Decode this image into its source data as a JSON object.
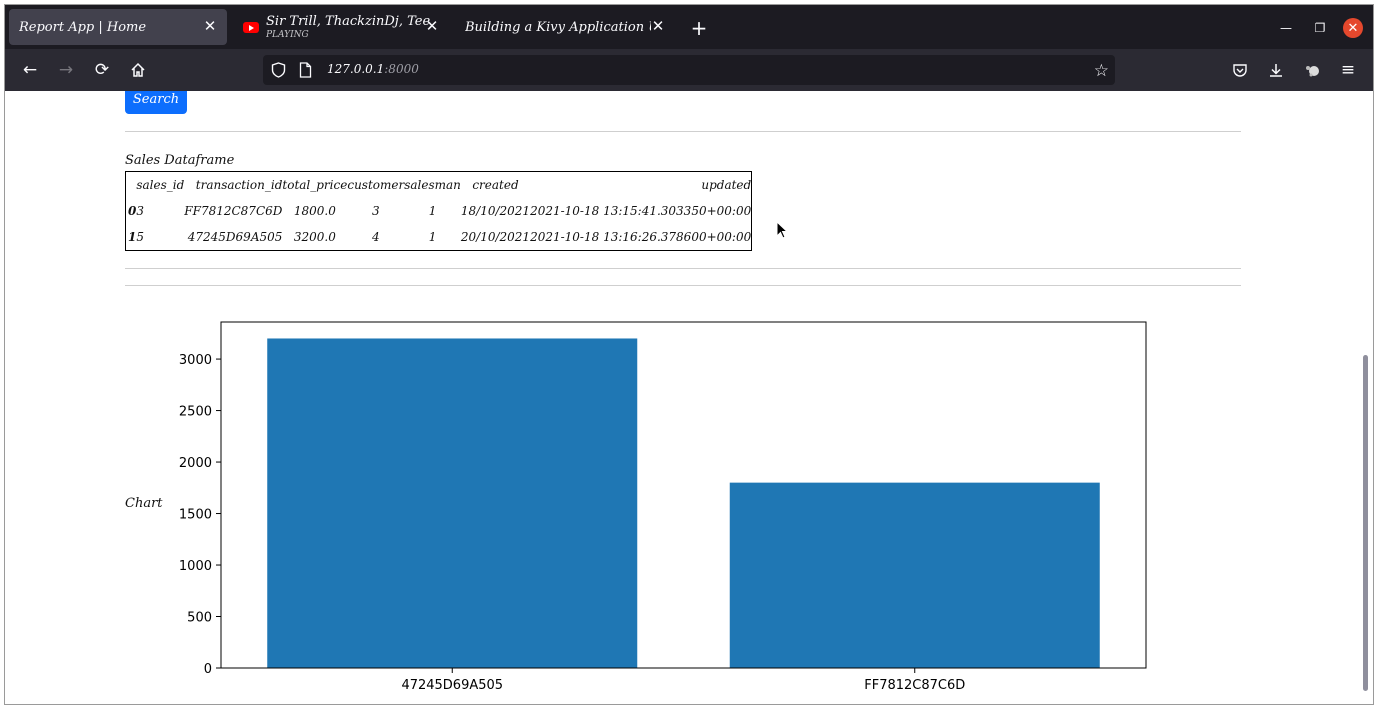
{
  "tabs": [
    {
      "title": "Report App | Home",
      "subtitle": ""
    },
    {
      "title": "Sir Trill, ThackzinDj, Tee Jay - ",
      "subtitle": "PLAYING"
    },
    {
      "title": "Building a Kivy Application Using ",
      "subtitle": ""
    }
  ],
  "url": {
    "host": "127.0.0.1",
    "port": ":8000"
  },
  "page": {
    "search_label": "Search",
    "dataframe_title": "Sales Dataframe",
    "chart_label": "Chart"
  },
  "dataframe": {
    "columns": [
      "",
      "sales_id",
      "transaction_id",
      "total_price",
      "customer",
      "salesman",
      "created",
      "updated"
    ],
    "rows": [
      [
        "0",
        "3",
        "FF7812C87C6D",
        "1800.0",
        "3",
        "1",
        "18/10/2021",
        "2021-10-18 13:15:41.303350+00:00"
      ],
      [
        "1",
        "5",
        "47245D69A505",
        "3200.0",
        "4",
        "1",
        "20/10/2021",
        "2021-10-18 13:16:26.378600+00:00"
      ]
    ]
  },
  "chart_data": {
    "type": "bar",
    "categories": [
      "47245D69A505",
      "FF7812C87C6D"
    ],
    "values": [
      3200,
      1800
    ],
    "title": "",
    "xlabel": "",
    "ylabel": "",
    "ylim": [
      0,
      3360
    ],
    "yticks": [
      0,
      500,
      1000,
      1500,
      2000,
      2500,
      3000
    ],
    "bar_color": "#1f77b4"
  },
  "colors": {
    "accent": "#0d6efd",
    "tabstrip_bg": "#1c1b22",
    "toolbar_bg": "#2b2a33",
    "close_button": "#e5482d"
  }
}
